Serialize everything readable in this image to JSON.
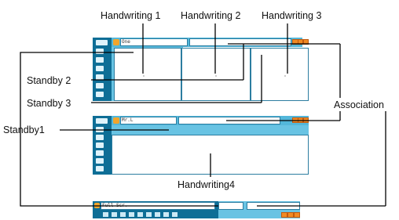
{
  "labels": {
    "hw1": "Handwriting 1",
    "hw2": "Handwriting 2",
    "hw3": "Handwriting 3",
    "standby2": "Standby 2",
    "standby3": "Standby 3",
    "standby1": "Standby1",
    "association": "Association",
    "hw4": "Handwriting4"
  },
  "panels": {
    "top_field": "One",
    "mid_field": "Mr.L",
    "bottom_field": "Full Scr."
  },
  "colors": {
    "sidebar": "#0e6e96",
    "toolbar": "#53b7da",
    "candidate": "#68c3e3",
    "buttons": "#f08a24"
  },
  "icons": [
    "app-logo-icon",
    "minimize-icon",
    "maximize-icon",
    "close-icon"
  ]
}
